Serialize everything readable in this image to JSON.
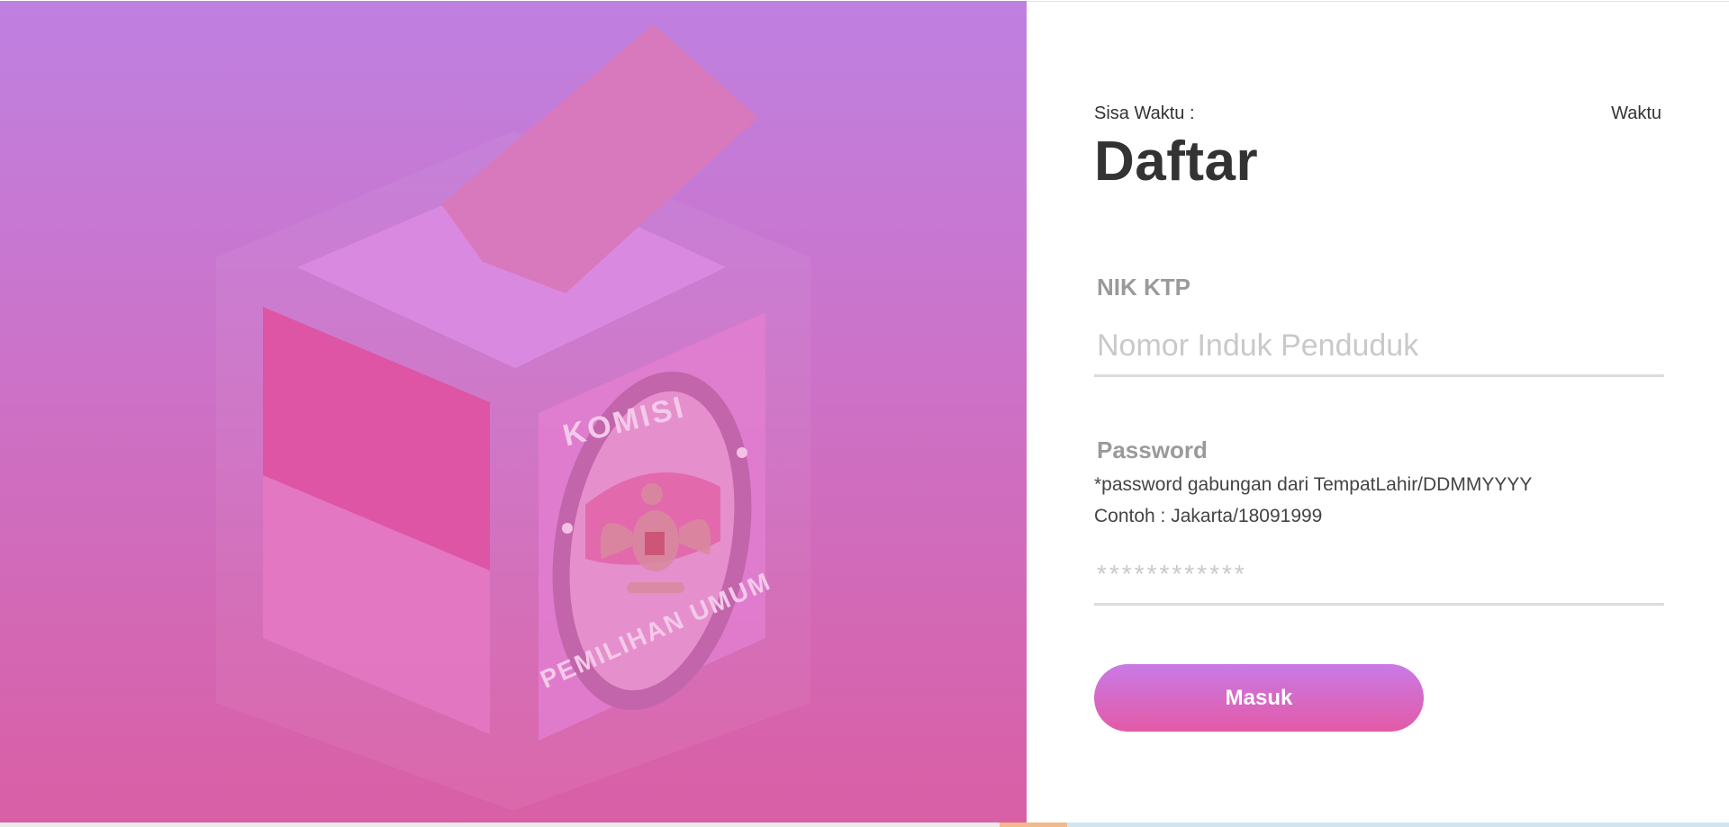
{
  "hero": {
    "emblem_top_text": "KOMISI",
    "emblem_bottom_text": "PEMILIHAN UMUM"
  },
  "form": {
    "timer_label": "Sisa Waktu :",
    "timer_value": "Waktu",
    "title": "Daftar",
    "nik_label": "NIK KTP",
    "nik_placeholder": "Nomor Induk Penduduk",
    "password_label": "Password",
    "password_hint": "*password gabungan dari TempatLahir/DDMMYYYY",
    "password_example": "Contoh : Jakarta/18091999",
    "password_placeholder": "************",
    "submit_label": "Masuk"
  },
  "colors": {
    "hero_top": "#bf80e0",
    "hero_bottom": "#d95fa5",
    "button_top": "#c97ae6",
    "button_bottom": "#e35aa6",
    "title": "#333333"
  },
  "icons": [
    "ballot-box-illustration",
    "kpu-emblem-icon"
  ]
}
